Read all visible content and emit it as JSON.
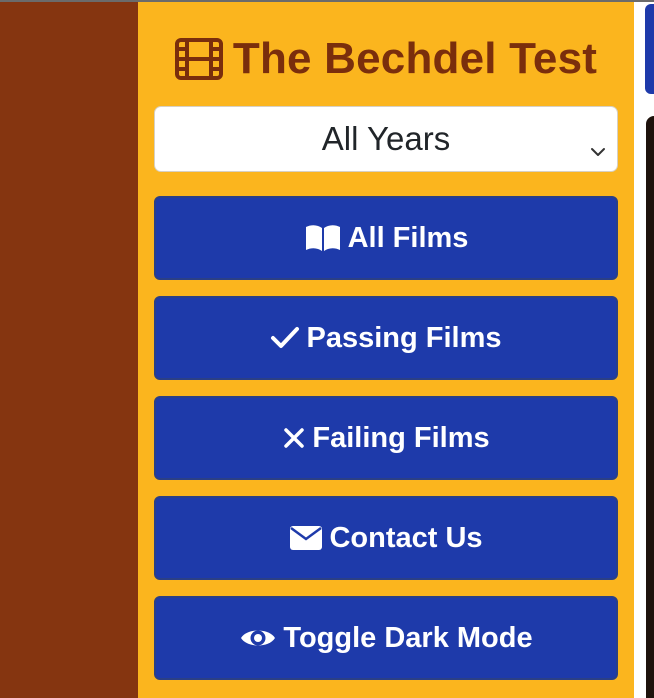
{
  "header": {
    "title": "The Bechdel Test",
    "icon": "film-icon"
  },
  "year_select": {
    "selected": "All Years",
    "icon": "chevron-down-icon"
  },
  "nav": [
    {
      "label": "All Films",
      "icon": "open-book-icon"
    },
    {
      "label": "Passing Films",
      "icon": "check-icon"
    },
    {
      "label": "Failing Films",
      "icon": "x-icon"
    },
    {
      "label": "Contact Us",
      "icon": "envelope-icon"
    },
    {
      "label": "Toggle Dark Mode",
      "icon": "eye-icon"
    }
  ],
  "colors": {
    "page_background": "#853510",
    "sidebar_background": "#fbb51e",
    "title_text": "#7a2e0c",
    "button_background": "#1e3aaa",
    "button_text": "#ffffff"
  }
}
